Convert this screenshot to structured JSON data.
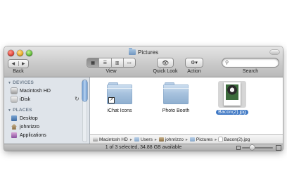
{
  "window": {
    "title": "Pictures"
  },
  "toolbar": {
    "back_glyph_left": "◀",
    "back_glyph_right": "▶",
    "back_label": "Back",
    "view_label": "View",
    "view_modes": [
      "icon-view",
      "list-view",
      "column-view",
      "coverflow-view"
    ],
    "quicklook_label": "Quick Look",
    "quicklook_glyph": "👁",
    "action_label": "Action",
    "action_glyph": "⚙▾",
    "search_label": "Search",
    "search_value": ""
  },
  "sidebar": {
    "devices_header": "DEVICES",
    "places_header": "PLACES",
    "devices": [
      {
        "label": "Macintosh HD",
        "icon": "hard-drive-icon"
      },
      {
        "label": "iDisk",
        "icon": "idisk-icon"
      }
    ],
    "places": [
      {
        "label": "Desktop",
        "icon": "desktop-icon"
      },
      {
        "label": "johnrizzo",
        "icon": "home-icon"
      },
      {
        "label": "Applications",
        "icon": "applications-icon"
      }
    ]
  },
  "files": [
    {
      "label": "iChat Icons",
      "kind": "folder",
      "alias": true
    },
    {
      "label": "Photo Booth",
      "kind": "folder",
      "alias": false
    },
    {
      "label": "Bacon(2).jpg",
      "kind": "image",
      "selected": true
    }
  ],
  "pathbar": [
    "Macintosh HD",
    "Users",
    "johnrizzo",
    "Pictures",
    "Bacon(2).jpg"
  ],
  "status": {
    "text": "1 of 3 selected, 34.88 GB available",
    "icon_size_level": 0.3
  },
  "colors": {
    "selection": "#3d77c4",
    "sidebar_bg": "#dfe4ea",
    "sidebar_header": "#6d7c8c"
  }
}
